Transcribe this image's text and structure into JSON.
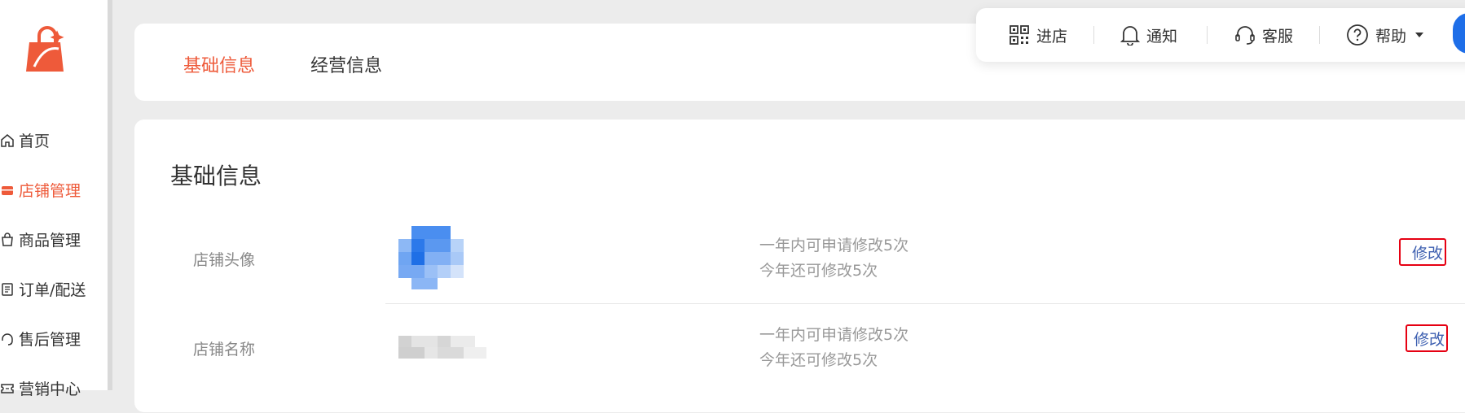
{
  "sidebar": {
    "nav": [
      {
        "label": "首页",
        "icon": "home-icon",
        "active": false
      },
      {
        "label": "店铺管理",
        "icon": "store-icon",
        "active": true
      },
      {
        "label": "商品管理",
        "icon": "bag-icon",
        "active": false
      },
      {
        "label": "订单/配送",
        "icon": "order-icon",
        "active": false
      },
      {
        "label": "售后管理",
        "icon": "headset-icon",
        "active": false
      },
      {
        "label": "营销中心",
        "icon": "ticket-icon",
        "active": false
      }
    ]
  },
  "tabs": [
    {
      "label": "基础信息",
      "active": true
    },
    {
      "label": "经营信息",
      "active": false
    }
  ],
  "toolbar": {
    "enter_store": "进店",
    "notify": "通知",
    "support": "客服",
    "help": "帮助"
  },
  "main": {
    "section_title": "基础信息",
    "rows": [
      {
        "label": "店铺头像",
        "note_line1": "一年内可申请修改5次",
        "note_line2": "今年还可修改5次",
        "action": "修改"
      },
      {
        "label": "店铺名称",
        "note_line1": "一年内可申请修改5次",
        "note_line2": "今年还可修改5次",
        "action": "修改"
      }
    ]
  },
  "colors": {
    "accent": "#ee5a3a",
    "link": "#3d5fb0",
    "highlight_box": "#e60012"
  }
}
